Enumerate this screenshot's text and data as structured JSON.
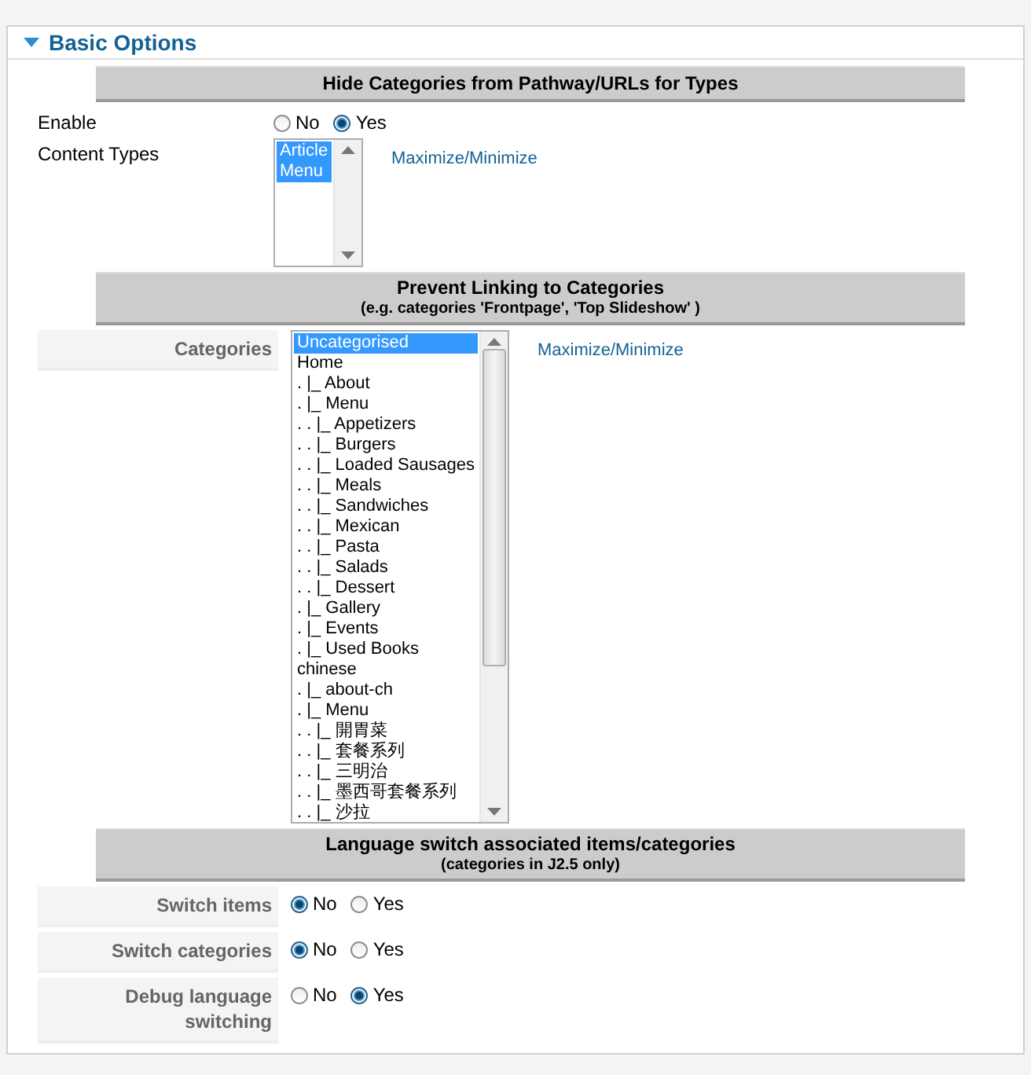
{
  "panel": {
    "title": "Basic Options",
    "expanded": true
  },
  "sections": [
    {
      "heading": "Hide Categories from Pathway/URLs for Types",
      "labels_shaded": false,
      "fields": [
        {
          "kind": "radio",
          "label": "Enable",
          "options": [
            {
              "label": "No",
              "selected": false
            },
            {
              "label": "Yes",
              "selected": true
            }
          ]
        },
        {
          "kind": "listbox",
          "label": "Content Types",
          "link": "Maximize/Minimize",
          "options": [
            {
              "label": "Article",
              "selected": true
            },
            {
              "label": "Menu",
              "selected": true
            }
          ]
        }
      ]
    },
    {
      "heading": "Prevent Linking to Categories",
      "note": "(e.g. categories 'Frontpage', 'Top Slideshow' )",
      "labels_shaded": true,
      "fields": [
        {
          "kind": "listbox",
          "label": "Categories",
          "link": "Maximize/Minimize",
          "options": [
            {
              "label": "Uncategorised",
              "selected": true
            },
            {
              "label": "Home",
              "selected": false
            },
            {
              "label": ". |_ About",
              "selected": false
            },
            {
              "label": ". |_ Menu",
              "selected": false
            },
            {
              "label": ". . |_ Appetizers",
              "selected": false
            },
            {
              "label": ". . |_ Burgers",
              "selected": false
            },
            {
              "label": ". . |_ Loaded Sausages",
              "selected": false
            },
            {
              "label": ". . |_ Meals",
              "selected": false
            },
            {
              "label": ". . |_ Sandwiches",
              "selected": false
            },
            {
              "label": ". . |_ Mexican",
              "selected": false
            },
            {
              "label": ". . |_ Pasta",
              "selected": false
            },
            {
              "label": ". . |_ Salads",
              "selected": false
            },
            {
              "label": ". . |_ Dessert",
              "selected": false
            },
            {
              "label": ". |_ Gallery",
              "selected": false
            },
            {
              "label": ". |_ Events",
              "selected": false
            },
            {
              "label": ". |_ Used Books",
              "selected": false
            },
            {
              "label": "chinese",
              "selected": false
            },
            {
              "label": ". |_ about-ch",
              "selected": false
            },
            {
              "label": ". |_ Menu",
              "selected": false
            },
            {
              "label": ". . |_ 開胃菜",
              "selected": false
            },
            {
              "label": ". . |_ 套餐系列",
              "selected": false
            },
            {
              "label": ". . |_ 三明治",
              "selected": false
            },
            {
              "label": ". . |_ 墨西哥套餐系列",
              "selected": false
            },
            {
              "label": ". . |_ 沙拉",
              "selected": false
            }
          ]
        }
      ]
    },
    {
      "heading": "Language switch associated items/categories",
      "note": "(categories in J2.5 only)",
      "labels_shaded": true,
      "fields": [
        {
          "kind": "radio",
          "label": "Switch items",
          "options": [
            {
              "label": "No",
              "selected": true
            },
            {
              "label": "Yes",
              "selected": false
            }
          ]
        },
        {
          "kind": "radio",
          "label": "Switch categories",
          "options": [
            {
              "label": "No",
              "selected": true
            },
            {
              "label": "Yes",
              "selected": false
            }
          ]
        },
        {
          "kind": "radio",
          "label": "Debug language switching",
          "options": [
            {
              "label": "No",
              "selected": false
            },
            {
              "label": "Yes",
              "selected": true
            }
          ]
        }
      ]
    }
  ]
}
